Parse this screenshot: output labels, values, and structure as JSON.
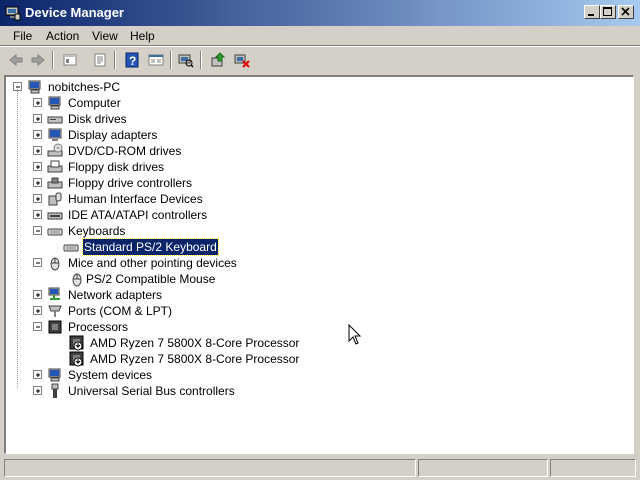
{
  "window": {
    "title": "Device Manager",
    "icon": "device-manager-icon"
  },
  "titlebar_buttons": [
    "minimize-icon",
    "maximize-icon",
    "close-icon"
  ],
  "menu": [
    {
      "label": "File"
    },
    {
      "label": "Action"
    },
    {
      "label": "View"
    },
    {
      "label": "Help"
    }
  ],
  "toolbar": {
    "buttons": [
      "back-icon",
      "forward-icon",
      "up-icon",
      "properties-icon",
      "help-icon",
      "view-icon",
      "scan-hardware-icon",
      "update-driver-icon",
      "uninstall-icon"
    ]
  },
  "tree": {
    "root": "nobitches-PC",
    "nodes": [
      {
        "label": "Computer",
        "icon": "computer-icon",
        "expanded": false
      },
      {
        "label": "Disk drives",
        "icon": "disk-drive-icon",
        "expanded": false
      },
      {
        "label": "Display adapters",
        "icon": "display-adapter-icon",
        "expanded": false
      },
      {
        "label": "DVD/CD-ROM drives",
        "icon": "dvd-drive-icon",
        "expanded": false
      },
      {
        "label": "Floppy disk drives",
        "icon": "floppy-drive-icon",
        "expanded": false
      },
      {
        "label": "Floppy drive controllers",
        "icon": "floppy-controller-icon",
        "expanded": false
      },
      {
        "label": "Human Interface Devices",
        "icon": "hid-icon",
        "expanded": false
      },
      {
        "label": "IDE ATA/ATAPI controllers",
        "icon": "ide-controller-icon",
        "expanded": false
      },
      {
        "label": "Keyboards",
        "icon": "keyboard-icon",
        "expanded": true,
        "children": [
          {
            "label": "Standard PS/2 Keyboard",
            "icon": "keyboard-icon",
            "selected": true
          }
        ]
      },
      {
        "label": "Mice and other pointing devices",
        "icon": "mouse-icon",
        "expanded": true,
        "children": [
          {
            "label": "PS/2 Compatible Mouse",
            "icon": "mouse-icon"
          }
        ]
      },
      {
        "label": "Network adapters",
        "icon": "network-adapter-icon",
        "expanded": false
      },
      {
        "label": "Ports (COM & LPT)",
        "icon": "port-icon",
        "expanded": false
      },
      {
        "label": "Processors",
        "icon": "processor-icon",
        "expanded": true,
        "children": [
          {
            "label": "AMD Ryzen 7 5800X 8-Core Processor",
            "icon": "processor-disabled-icon"
          },
          {
            "label": "AMD Ryzen 7 5800X 8-Core Processor",
            "icon": "processor-disabled-icon"
          }
        ]
      },
      {
        "label": "System devices",
        "icon": "system-devices-icon",
        "expanded": false
      },
      {
        "label": "Universal Serial Bus controllers",
        "icon": "usb-icon",
        "expanded": false
      }
    ]
  },
  "colors": {
    "title_start": "#0a246a",
    "title_end": "#a6caf0",
    "selection": "#0a246a",
    "chrome": "#d4d0c8"
  }
}
